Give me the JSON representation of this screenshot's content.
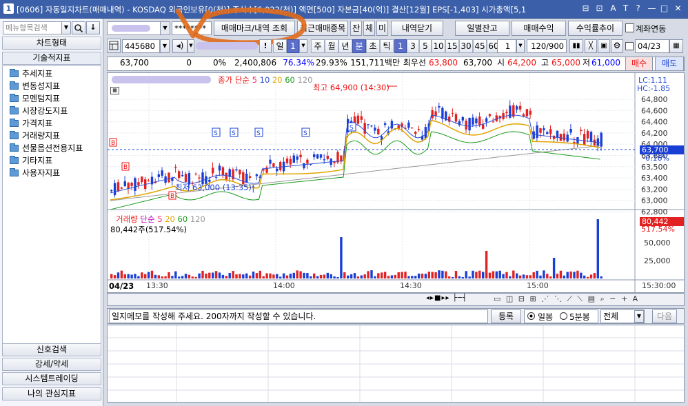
{
  "window": {
    "title_num": "1",
    "title": "[0606] 자동일지차트(매매내역) - KOSDAQ 외국인보유[0(천)] 주식수[6,022(천)] 액면[500] 자본금[40(억)] 결산[12월] EPS[-1,403] 시가총액[5,1",
    "sys": [
      "⊟",
      "⊡",
      "A",
      "T",
      "?",
      "—",
      "□",
      "✕"
    ]
  },
  "left": {
    "search_placeholder": "메뉴항목검색",
    "header": "차트형태",
    "sub": "기술적지표",
    "tree": [
      "추세지표",
      "변동성지표",
      "모멘텀지표",
      "시장강도지표",
      "가격지표",
      "거래량지표",
      "선물옵션전용지표",
      "기타지표",
      "사용자지표"
    ],
    "bottom": [
      "신호검색",
      "강세/약세",
      "시스템트레이딩",
      "나의 관심지표"
    ]
  },
  "toolbar": {
    "account_mask": "********",
    "trade_mark_btn": "매매마크/내역 조회",
    "recent_btn": "최근매매종목",
    "jan": "잔",
    "che": "체",
    "mi": "미",
    "close_btn": "내역닫기",
    "daily_btn": "일별잔고",
    "profit_btn": "매매수익",
    "yield_btn": "수익률추이",
    "account_link_label": "계좌연동"
  },
  "row2": {
    "code": "445680",
    "periods": [
      "일",
      "주",
      "월",
      "년",
      "분",
      "초",
      "틱"
    ],
    "nums": [
      "1",
      "3",
      "5",
      "10",
      "15",
      "30",
      "45",
      "60"
    ],
    "count": "1",
    "range": "120/900",
    "date": "04/23"
  },
  "info": {
    "price": "63,700",
    "change": "0",
    "pct": "0%",
    "volume": "2,400,806",
    "rate1": "76.34%",
    "rate2": "29.93%",
    "amount": "151,711백만",
    "best_label": "최우선",
    "best": "63,800",
    "best2": "63,700",
    "open_label": "시",
    "open": "64,200",
    "high_label": "고",
    "high": "65,000",
    "low_label": "저",
    "low": "61,000",
    "buy": "매수",
    "sell": "매도"
  },
  "chart": {
    "legend": {
      "name": "종가 단순",
      "ma": [
        "5",
        "10",
        "20",
        "60",
        "120"
      ]
    },
    "high_note": "최고 64,900 (14:30)",
    "low_note": "최저 63,000 (13:35)",
    "lc": "LC:1.11",
    "hc": "HC:-1.85",
    "yticks": [
      "64,800",
      "64,600",
      "64,400",
      "64,200",
      "64,000",
      "63,800",
      "63,500",
      "63,400",
      "63,200",
      "63,000",
      "62,800"
    ],
    "cur_price": "63,700",
    "cur_pct": "-0.16%",
    "vol_legend": {
      "name": "거래량",
      "mode": "단순",
      "ma": [
        "5",
        "20",
        "60",
        "120"
      ]
    },
    "vol_text": "80,442주(517.54%)",
    "vol_ticks": [
      "50,000",
      "25,000"
    ],
    "vol_cur": "80,442",
    "vol_cur_pct": "517.54%",
    "xticks": [
      "13:30",
      "14:00",
      "14:30",
      "15:00"
    ],
    "x_first": "04/23",
    "x_last": "15:30:00",
    "colors": {
      "up": "#e22222",
      "down": "#1a3fd6"
    }
  },
  "memo": {
    "placeholder": "일지메모를 작성해 주세요. 200자까지 작성할 수 있습니다.",
    "register": "등록",
    "opt1": "일봉",
    "opt2": "5분봉",
    "filter": "전체",
    "next": "다음"
  }
}
